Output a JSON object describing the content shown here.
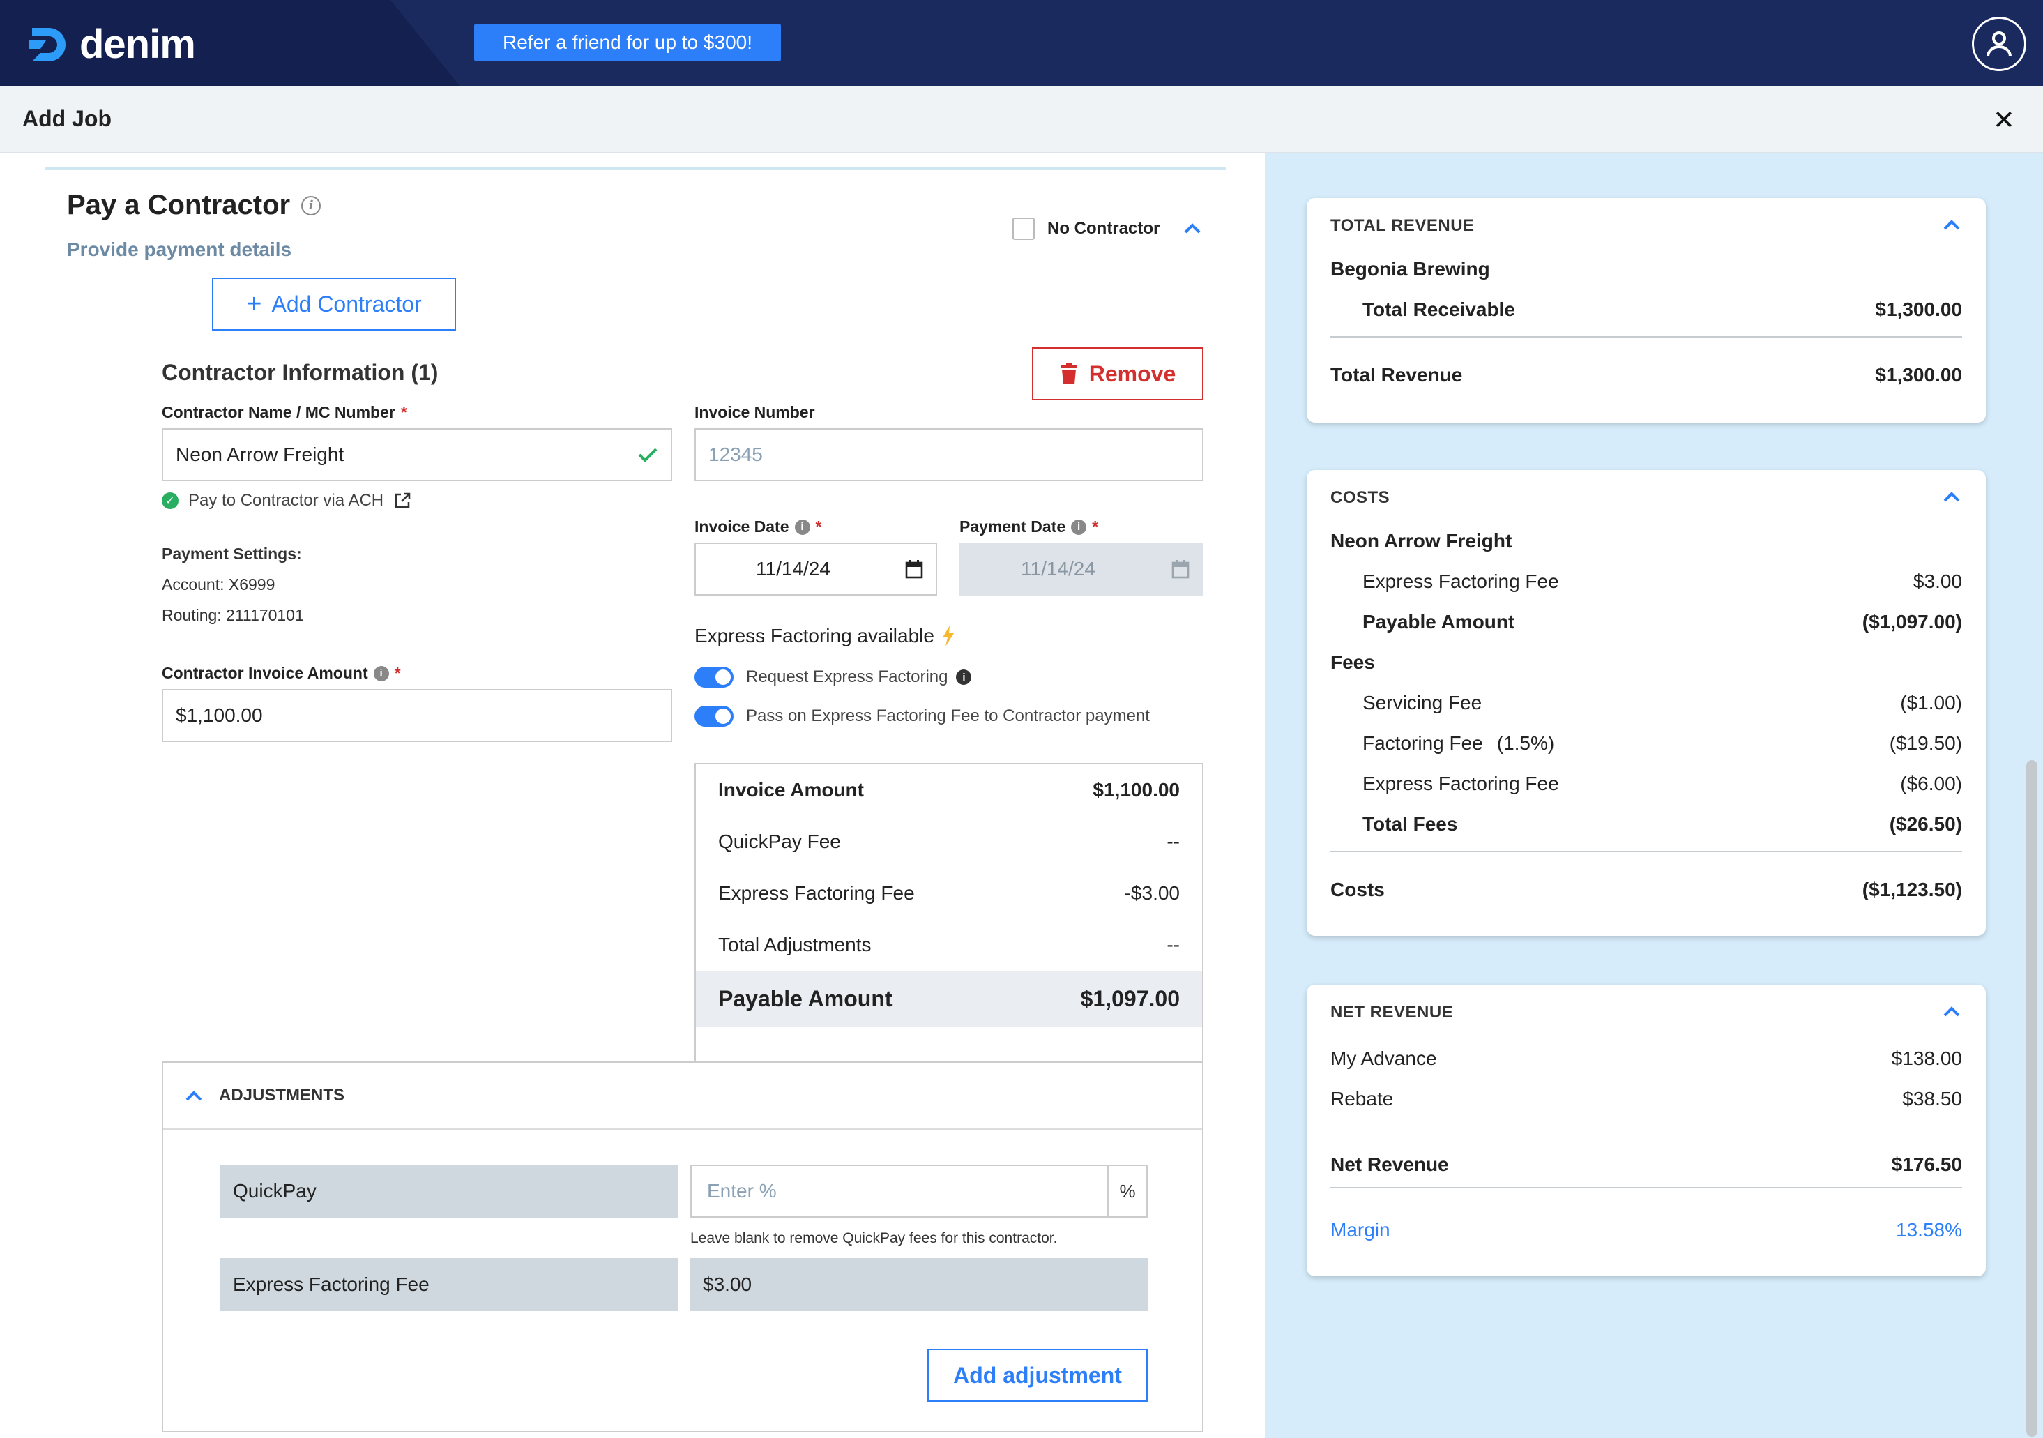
{
  "app": {
    "brand": "denim",
    "refer_label": "Refer a friend for up to $300!",
    "page_title": "Add Job"
  },
  "pay_contractor": {
    "title": "Pay a Contractor",
    "subtitle": "Provide payment details",
    "no_contractor_label": "No Contractor",
    "no_contractor_checked": false,
    "add_contractor_label": "Add Contractor",
    "info_title": "Contractor Information (1)",
    "remove_label": "Remove",
    "name_label": "Contractor Name / MC Number",
    "name_value": "Neon Arrow Freight",
    "invoice_number_label": "Invoice Number",
    "invoice_number_placeholder": "12345",
    "ach_label": "Pay to Contractor via ACH",
    "payment_settings_label": "Payment Settings:",
    "account": "Account: X6999",
    "routing": "Routing: 211170101",
    "invoice_date_label": "Invoice Date",
    "invoice_date_value": "11/14/24",
    "payment_date_label": "Payment Date",
    "payment_date_value": "11/14/24",
    "amount_label": "Contractor Invoice Amount",
    "amount_value": "$1,100.00",
    "express_available_label": "Express Factoring available",
    "toggle_request_label": "Request Express Factoring",
    "toggle_request_on": true,
    "toggle_passon_label": "Pass on Express Factoring Fee to Contractor payment",
    "toggle_passon_on": true
  },
  "summary": {
    "rows": [
      {
        "label": "Invoice Amount",
        "value": "$1,100.00"
      },
      {
        "label": "QuickPay Fee",
        "value": "--"
      },
      {
        "label": "Express Factoring Fee",
        "value": "-$3.00"
      },
      {
        "label": "Total Adjustments",
        "value": "--"
      }
    ],
    "total_label": "Payable Amount",
    "total_value": "$1,097.00"
  },
  "adjustments": {
    "title": "ADJUSTMENTS",
    "quickpay_label": "QuickPay",
    "quickpay_placeholder": "Enter %",
    "quickpay_suffix": "%",
    "quickpay_hint": "Leave blank to remove QuickPay fees for this contractor.",
    "express_label": "Express Factoring Fee",
    "express_value": "$3.00",
    "add_label": "Add adjustment"
  },
  "total_revenue": {
    "title": "TOTAL REVENUE",
    "customer": "Begonia Brewing",
    "receivable_label": "Total Receivable",
    "receivable_value": "$1,300.00",
    "total_label": "Total Revenue",
    "total_value": "$1,300.00"
  },
  "costs": {
    "title": "COSTS",
    "contractor": "Neon Arrow Freight",
    "express_fee_label": "Express Factoring Fee",
    "express_fee_value": "$3.00",
    "payable_label": "Payable Amount",
    "payable_value": "($1,097.00)",
    "fees_title": "Fees",
    "servicing_label": "Servicing Fee",
    "servicing_value": "($1.00)",
    "factoring_label": "Factoring Fee",
    "factoring_pct": "(1.5%)",
    "factoring_value": "($19.50)",
    "express2_label": "Express Factoring Fee",
    "express2_value": "($6.00)",
    "total_fees_label": "Total Fees",
    "total_fees_value": "($26.50)",
    "costs_label": "Costs",
    "costs_value": "($1,123.50)"
  },
  "net_revenue": {
    "title": "NET REVENUE",
    "advance_label": "My Advance",
    "advance_value": "$138.00",
    "rebate_label": "Rebate",
    "rebate_value": "$38.50",
    "net_label": "Net Revenue",
    "net_value": "$176.50",
    "margin_label": "Margin",
    "margin_value": "13.58%"
  },
  "colors": {
    "brand_navy": "#1b2a5e",
    "accent_blue": "#2d7ff9",
    "danger_red": "#d32f2f",
    "success_green": "#27ae60",
    "side_panel_bg": "#d6ecfa"
  },
  "icons": [
    "denim-logo-icon",
    "user-icon",
    "close-icon",
    "info-icon",
    "chevron-up-icon",
    "plus-icon",
    "trash-icon",
    "check-icon",
    "external-link-icon",
    "calendar-icon",
    "lightning-icon"
  ]
}
